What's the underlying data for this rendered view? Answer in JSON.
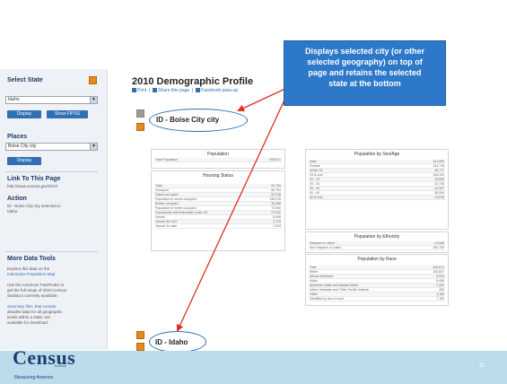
{
  "sidebar": {
    "select_state_title": "Select State",
    "state_value": "Idaho",
    "display_label": "Display",
    "show_map_label": "Show FIPSS",
    "places_title": "Places",
    "place_value": "Boise City city",
    "display2_label": "Display",
    "link_title": "Link To This Page",
    "link_text": "http://www.census.gov/2010",
    "action_title": "Action",
    "action_text_1": "ID - Boise City city selected in",
    "action_text_2": "Idaho",
    "more_tools_title": "More Data Tools",
    "more_tools_text_1": "Explore this data on the",
    "more_tools_link": "Interactive Population Map",
    "more_tools_text_2": "Use the American FactFinder to",
    "more_tools_text_3": "get the full range of 2010 Census",
    "more_tools_text_4": "Statistics currently available.",
    "more_tools_text_5": "Summary files, that contain",
    "more_tools_text_6": "detailed data for all geographic",
    "more_tools_text_7": "levels within a state, are",
    "more_tools_text_8": "available for download."
  },
  "main": {
    "title": "2010 Demographic Profile",
    "tools_print": "Print",
    "tools_share": "Share this page",
    "tools_facebook": "Facebook pass-up",
    "top_geo_label": "ID - Boise City city",
    "bottom_geo_label": "ID - Idaho"
  },
  "tables": {
    "population_title": "Population",
    "population_rows": [
      {
        "k": "Total Population",
        "v": "205,671"
      }
    ],
    "housing_title": "Housing Status",
    "housing_rows": [
      {
        "k": "Total",
        "v": "92,700"
      },
      {
        "k": "Occupied",
        "v": "85,704"
      },
      {
        "k": "Owner-occupied",
        "v": "52,216"
      },
      {
        "k": "Population in owner-occupied",
        "v": "136,376"
      },
      {
        "k": "Renter-occupied",
        "v": "33,488"
      },
      {
        "k": "Population in renter-occupied",
        "v": "73,969"
      },
      {
        "k": "Households with individuals under 18",
        "v": "27,032"
      },
      {
        "k": "Vacant",
        "v": "6,996"
      },
      {
        "k": "Vacant: for rent",
        "v": "3,176"
      },
      {
        "k": "Vacant: for sale",
        "v": "1,003"
      }
    ],
    "age_title": "Population by Sex/Age",
    "age_rows": [
      {
        "k": "Male",
        "v": "101,953"
      },
      {
        "k": "Female",
        "v": "103,718"
      },
      {
        "k": "Under 18",
        "v": "48,771"
      },
      {
        "k": "18 & over",
        "v": "156,900"
      },
      {
        "k": "20 - 24",
        "v": "16,895"
      },
      {
        "k": "25 - 34",
        "v": "32,738"
      },
      {
        "k": "35 - 49",
        "v": "41,907"
      },
      {
        "k": "50 - 64",
        "v": "38,054"
      },
      {
        "k": "65 & over",
        "v": "23,878"
      }
    ],
    "ethnicity_title": "Population by Ethnicity",
    "ethnicity_rows": [
      {
        "k": "Hispanic or Latino",
        "v": "14,966"
      },
      {
        "k": "Non Hispanic or Latino",
        "v": "190,705"
      }
    ],
    "race_title": "Population by Race",
    "race_rows": [
      {
        "k": "Total",
        "v": "205,671"
      },
      {
        "k": "White",
        "v": "183,847"
      },
      {
        "k": "African American",
        "v": "3,043"
      },
      {
        "k": "Asian",
        "v": "6,498"
      },
      {
        "k": "American Indian and Alaska Native",
        "v": "1,452"
      },
      {
        "k": "Native Hawaiian and Other Pacific Islander",
        "v": "465"
      },
      {
        "k": "Other",
        "v": "3,186"
      },
      {
        "k": "Identified by two or more",
        "v": "7,180"
      }
    ]
  },
  "callout": {
    "text_1": "Displays selected city (or other",
    "text_2": "selected geography) on top of",
    "text_3": "page and retains the selected",
    "text_4": "state at the bottom"
  },
  "footer": {
    "logo": "Census",
    "logo_sub": "Bureau",
    "tagline": "Measuring America",
    "slide_number": "11"
  },
  "colors": {
    "callout_bg": "#2e78c9",
    "arrow": "#e0301e",
    "oval": "#2f6fb3",
    "footer_bg": "#bcdcec",
    "logo": "#1c3f72"
  }
}
